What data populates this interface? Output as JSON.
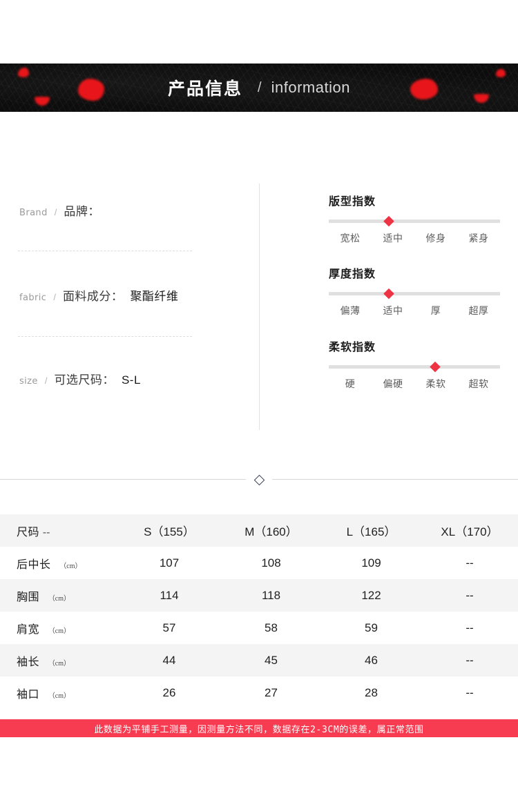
{
  "banner": {
    "title_cn": "产品信息",
    "separator": "/",
    "title_en": "information"
  },
  "specs": [
    {
      "en": "Brand",
      "slash": "/",
      "cn": "品牌：",
      "value": ""
    },
    {
      "en": "fabric",
      "slash": "/",
      "cn": "面料成分：",
      "value": "聚酯纤维"
    },
    {
      "en": "size",
      "slash": "/",
      "cn": "可选尺码：",
      "value": "S-L"
    }
  ],
  "indices": [
    {
      "title": "版型指数",
      "marker_percent": 35,
      "labels": [
        "宽松",
        "适中",
        "修身",
        "紧身"
      ]
    },
    {
      "title": "厚度指数",
      "marker_percent": 35,
      "labels": [
        "偏薄",
        "适中",
        "厚",
        "超厚"
      ]
    },
    {
      "title": "柔软指数",
      "marker_percent": 62,
      "labels": [
        "硬",
        "偏硬",
        "柔软",
        "超软"
      ]
    }
  ],
  "ornament": {
    "icon": "diamond-outline-icon"
  },
  "size_table": {
    "header": {
      "label": "尺码",
      "unit": "--",
      "columns": [
        "S（155）",
        "M（160）",
        "L（165）",
        "XL（170）"
      ]
    },
    "rows": [
      {
        "label": "后中长",
        "unit": "（cm）",
        "values": [
          "107",
          "108",
          "109",
          "--"
        ]
      },
      {
        "label": "胸围",
        "unit": "（cm）",
        "values": [
          "114",
          "118",
          "122",
          "--"
        ]
      },
      {
        "label": "肩宽",
        "unit": "（cm）",
        "values": [
          "57",
          "58",
          "59",
          "--"
        ]
      },
      {
        "label": "袖长",
        "unit": "（cm）",
        "values": [
          "44",
          "45",
          "46",
          "--"
        ]
      },
      {
        "label": "袖口",
        "unit": "（cm）",
        "values": [
          "26",
          "27",
          "28",
          "--"
        ]
      }
    ]
  },
  "footnote": {
    "text": "此数据为平铺手工测量，因测量方法不同，数据存在2-3CM的误差，属正常范围",
    "background_color": "#f73b50"
  },
  "colors": {
    "banner_background": "#0d0d0d",
    "petal_red": "#e8161a",
    "marker_red": "#ee3344",
    "table_alt_row": "#f4f4f4",
    "footnote_red": "#f73b50"
  }
}
